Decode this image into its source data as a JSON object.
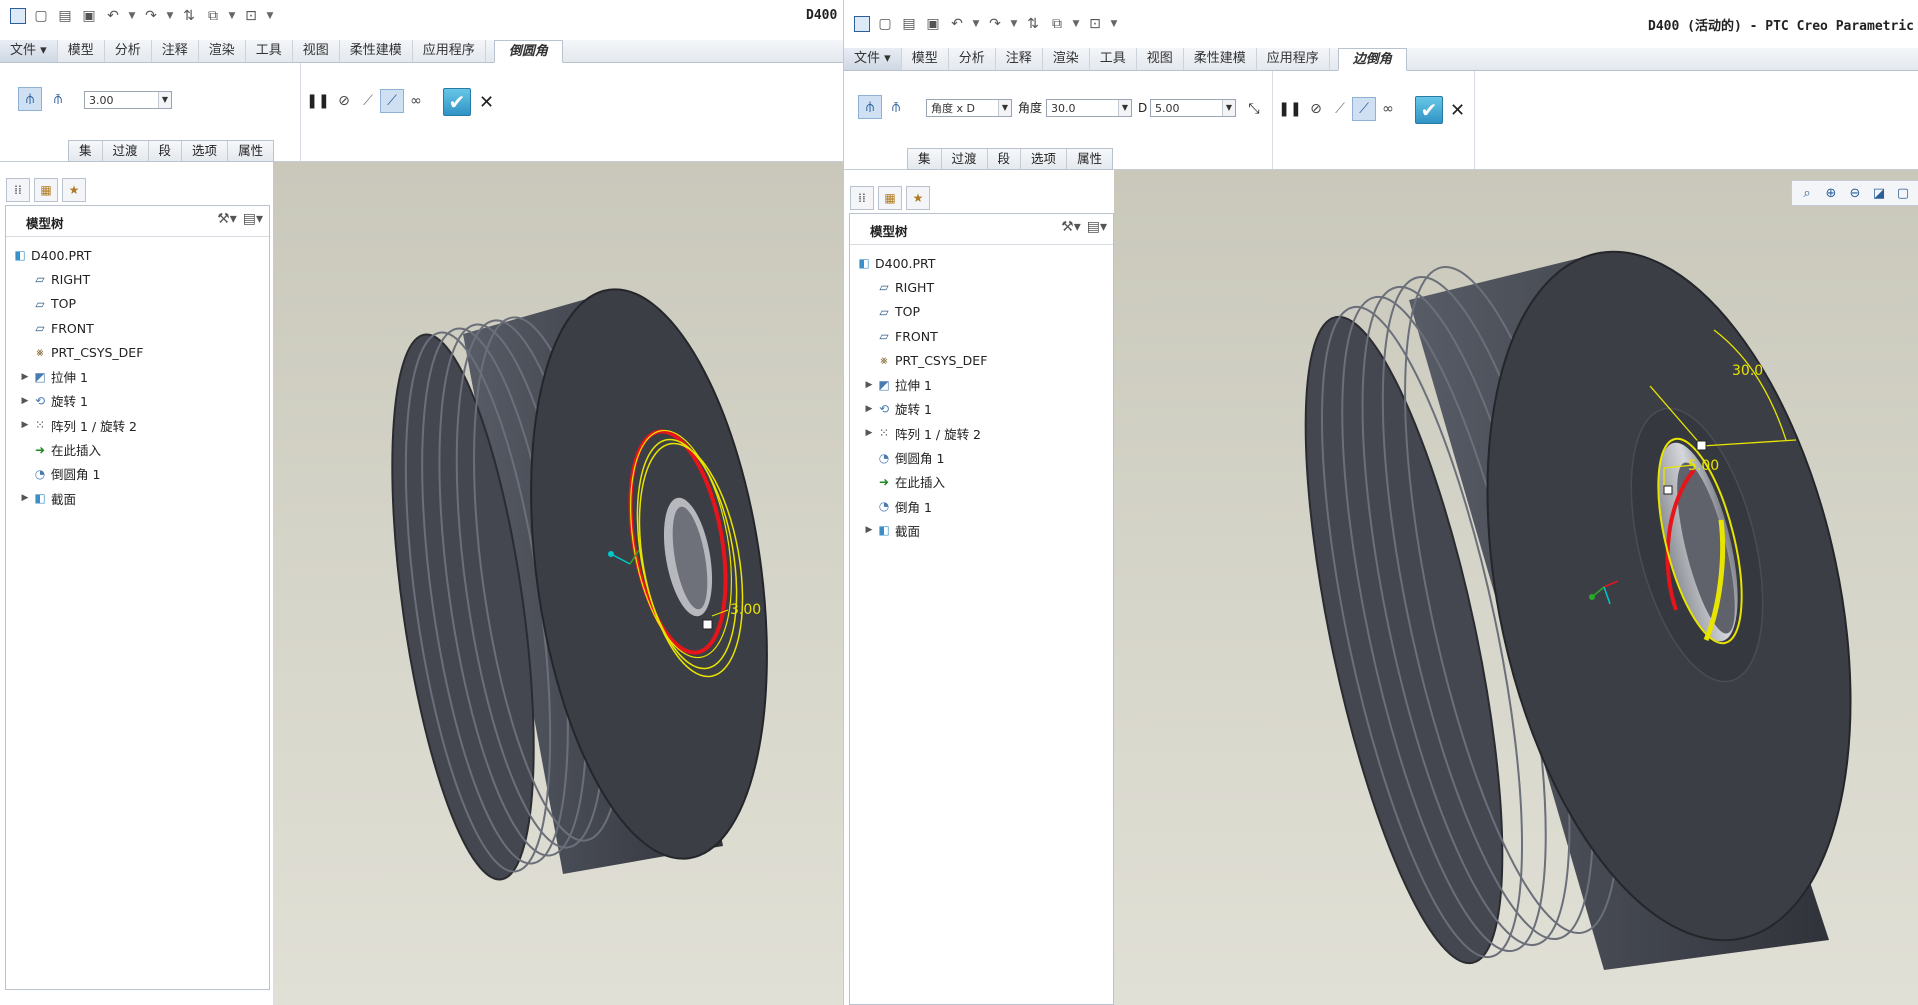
{
  "left": {
    "window_title": "D400",
    "file_tab": "文件",
    "tabs": [
      "模型",
      "分析",
      "注释",
      "渲染",
      "工具",
      "视图",
      "柔性建模",
      "应用程序"
    ],
    "active_tab": "倒圆角",
    "radius_value": "3.00",
    "subtabs": [
      "集",
      "过渡",
      "段",
      "选项",
      "属性"
    ],
    "tree_title": "模型树",
    "tree": [
      "D400.PRT",
      "RIGHT",
      "TOP",
      "FRONT",
      "PRT_CSYS_DEF",
      "拉伸 1",
      "旋转 1",
      "阵列 1 / 旋转 2",
      "在此插入",
      "倒圆角 1",
      "截面"
    ],
    "dim_label": "3.00"
  },
  "right": {
    "window_title": "D400 (活动的) - PTC Creo Parametric",
    "file_tab": "文件",
    "tabs": [
      "模型",
      "分析",
      "注释",
      "渲染",
      "工具",
      "视图",
      "柔性建模",
      "应用程序"
    ],
    "active_tab": "边倒角",
    "scheme_value": "角度 x D",
    "angle_label": "角度",
    "angle_value": "30.0",
    "d_label": "D",
    "d_value": "5.00",
    "subtabs": [
      "集",
      "过渡",
      "段",
      "选项",
      "属性"
    ],
    "tree_title": "模型树",
    "tree": [
      "D400.PRT",
      "RIGHT",
      "TOP",
      "FRONT",
      "PRT_CSYS_DEF",
      "拉伸 1",
      "旋转 1",
      "阵列 1 / 旋转 2",
      "倒圆角 1",
      "在此插入",
      "倒角 1",
      "截面"
    ],
    "dim_angle": "30.0",
    "dim_d": "5.00"
  },
  "icons": {
    "pause": "pause-icon",
    "cancel_preview": "no-preview-icon",
    "preview": "preview-icon",
    "verify": "verify-glasses-icon",
    "ok": "checkmark-icon",
    "close": "close-icon"
  },
  "colors": {
    "ribbon_blue": "#2b5f9a",
    "viewport_bg": "#d6d5c9",
    "model": "#3c3f47",
    "highlight_red": "#e8141b",
    "highlight_yellow": "#e8e400"
  }
}
